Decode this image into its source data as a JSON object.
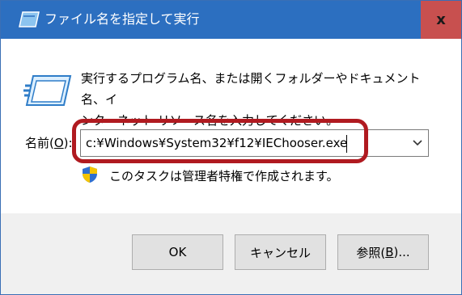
{
  "window": {
    "title": "ファイル名を指定して実行",
    "close_label": "x"
  },
  "content": {
    "description": "実行するプログラム名、または開くフォルダーやドキュメント名、イ\nンターネット リソース名を入力してください。",
    "open_label_prefix": "名前(",
    "open_label_accel": "O",
    "open_label_suffix": "):",
    "command_value": "c:¥Windows¥System32¥f12¥IEChooser.exe",
    "admin_note": "このタスクは管理者特権で作成されます。"
  },
  "buttons": {
    "ok": "OK",
    "cancel": "キャンセル",
    "browse_prefix": "参照(",
    "browse_accel": "B",
    "browse_suffix": ")..."
  },
  "colors": {
    "titlebar": "#2c6fc0",
    "close": "#c8504f",
    "highlight": "#b01a20"
  },
  "icons": [
    "run-app-icon",
    "run-dialog-icon",
    "chevron-down-icon",
    "uac-shield-icon"
  ]
}
